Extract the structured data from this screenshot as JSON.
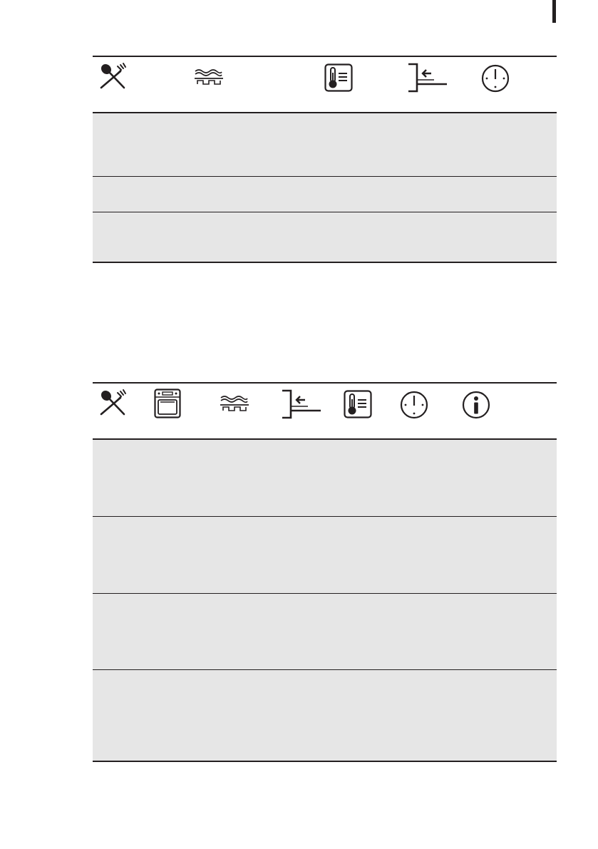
{
  "tables": [
    {
      "id": "table-1",
      "header_icons": [
        "cutlery-icon",
        "rack-icon",
        "thermometer-icon",
        "shelf-level-icon",
        "clock-icon"
      ],
      "rows": [
        {
          "cells": []
        },
        {
          "cells": []
        },
        {
          "cells": []
        }
      ]
    },
    {
      "id": "table-2",
      "header_icons": [
        "cutlery-icon",
        "oven-icon",
        "rack-icon",
        "shelf-level-icon",
        "thermometer-icon",
        "clock-icon",
        "info-icon"
      ],
      "rows": [
        {
          "cells": []
        },
        {
          "cells": []
        },
        {
          "cells": []
        },
        {
          "cells": []
        }
      ]
    }
  ],
  "colors": {
    "ink": "#231f20",
    "row_fill": "#e6e6e6",
    "background": "#ffffff"
  }
}
